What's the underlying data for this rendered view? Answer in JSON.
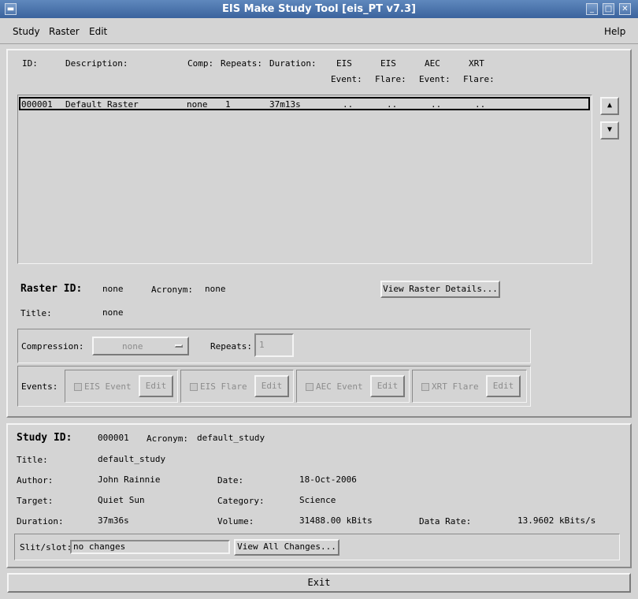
{
  "window": {
    "title": "EIS Make Study Tool [eis_PT v7.3]"
  },
  "menubar": {
    "study": "Study",
    "raster": "Raster",
    "edit": "Edit",
    "help": "Help"
  },
  "list_headers": {
    "id": "ID:",
    "description": "Description:",
    "comp": "Comp:",
    "repeats": "Repeats:",
    "duration": "Duration:",
    "eis_event_1": "EIS",
    "eis_event_2": "Event:",
    "eis_flare_1": "EIS",
    "eis_flare_2": "Flare:",
    "aec_event_1": "AEC",
    "aec_event_2": "Event:",
    "xrt_flare_1": "XRT",
    "xrt_flare_2": "Flare:"
  },
  "list_rows": [
    {
      "id": "000001",
      "description": "Default_Raster",
      "comp": "none",
      "repeats": "1",
      "duration": "37m13s",
      "eis_event": "..",
      "eis_flare": "..",
      "aec_event": "..",
      "xrt_flare": ".."
    }
  ],
  "raster": {
    "id_label": "Raster ID:",
    "id_value": "none",
    "acronym_label": "Acronym:",
    "acronym_value": "none",
    "title_label": "Title:",
    "title_value": "none",
    "view_details": "View Raster Details...",
    "compression_label": "Compression:",
    "compression_value": "none",
    "repeats_label": "Repeats:",
    "repeats_value": "1",
    "events_label": "Events:",
    "events": [
      {
        "label": "EIS Event",
        "edit": "Edit"
      },
      {
        "label": "EIS Flare",
        "edit": "Edit"
      },
      {
        "label": "AEC Event",
        "edit": "Edit"
      },
      {
        "label": "XRT Flare",
        "edit": "Edit"
      }
    ]
  },
  "study": {
    "id_label": "Study ID:",
    "id_value": "000001",
    "acronym_label": "Acronym:",
    "acronym_value": "default_study",
    "title_label": "Title:",
    "title_value": "default_study",
    "author_label": "Author:",
    "author_value": "John Rainnie",
    "date_label": "Date:",
    "date_value": "18-Oct-2006",
    "target_label": "Target:",
    "target_value": "Quiet Sun",
    "category_label": "Category:",
    "category_value": "Science",
    "duration_label": "Duration:",
    "duration_value": "37m36s",
    "volume_label": "Volume:",
    "volume_value": "31488.00 kBits",
    "rate_label": "Data Rate:",
    "rate_value": "13.9602 kBits/s",
    "slit_label": "Slit/slot:",
    "slit_value": "no changes",
    "view_all": "View All Changes..."
  },
  "footer": {
    "exit": "Exit"
  }
}
